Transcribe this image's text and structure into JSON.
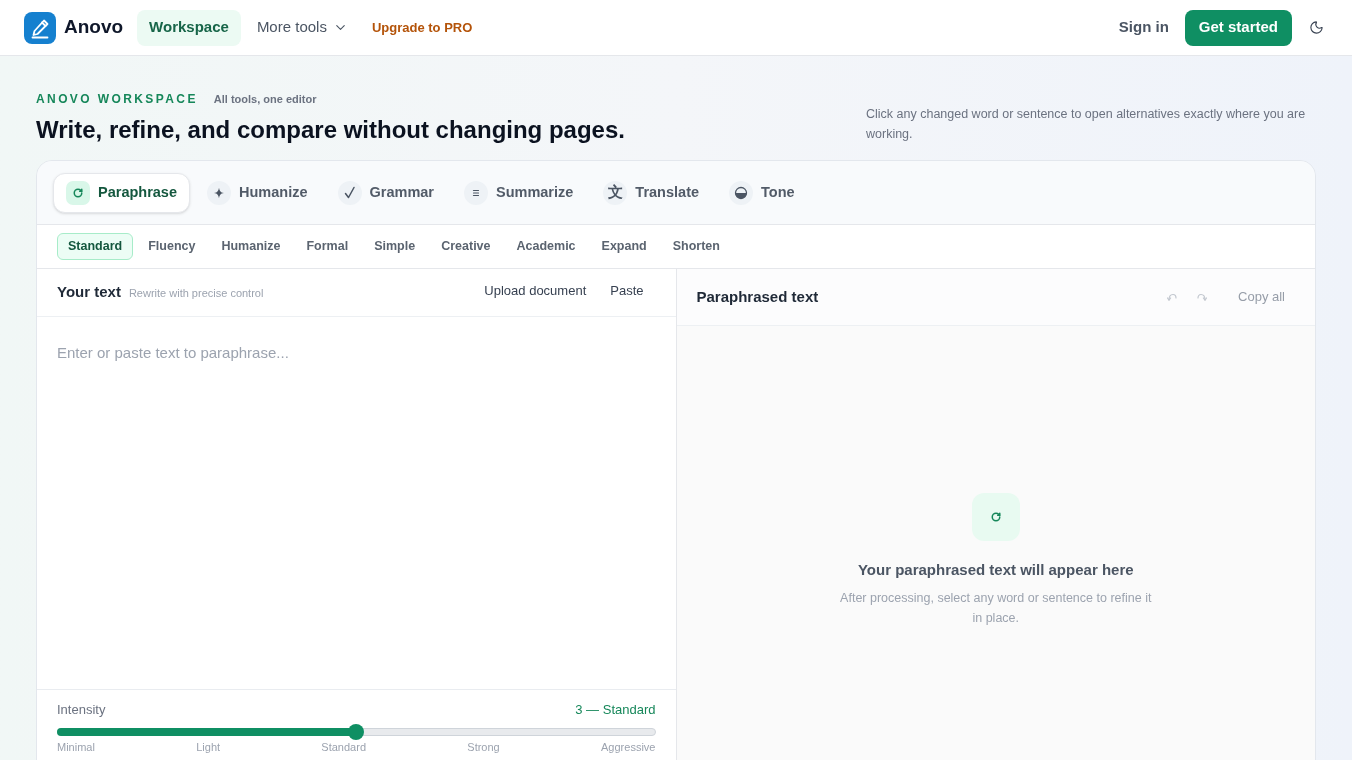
{
  "header": {
    "brand": "Anovo",
    "nav": [
      {
        "label": "Workspace",
        "kind": "link",
        "selected": true
      },
      {
        "label": "More tools",
        "kind": "dropdown",
        "selected": false
      }
    ],
    "upgrade": "Upgrade to PRO",
    "sign_in": "Sign in",
    "cta": "Get started"
  },
  "hero": {
    "eyebrow": "ANOVO WORKSPACE",
    "tagline": "All tools, one editor",
    "title": "Write, refine, and compare without changing pages.",
    "note": "Click any changed word or sentence to open alternatives exactly where you are working."
  },
  "tools": [
    {
      "label": "Paraphrase",
      "kind": "cycle",
      "selected": true
    },
    {
      "label": "Humanize",
      "kind": "sparkle",
      "selected": false
    },
    {
      "label": "Grammar",
      "kind": "check",
      "selected": false
    },
    {
      "label": "Summarize",
      "kind": "lines",
      "selected": false
    },
    {
      "label": "Translate",
      "kind": "glyph",
      "glyph": "文",
      "selected": false
    },
    {
      "label": "Tone",
      "kind": "half",
      "selected": false
    }
  ],
  "modes": [
    {
      "label": "Standard",
      "selected": true
    },
    {
      "label": "Fluency",
      "selected": false
    },
    {
      "label": "Humanize",
      "selected": false
    },
    {
      "label": "Formal",
      "selected": false
    },
    {
      "label": "Simple",
      "selected": false
    },
    {
      "label": "Creative",
      "selected": false
    },
    {
      "label": "Academic",
      "selected": false
    },
    {
      "label": "Expand",
      "selected": false
    },
    {
      "label": "Shorten",
      "selected": false
    }
  ],
  "editor": {
    "title": "Your text",
    "subtitle": "Rewrite with precise control",
    "actions": [
      "Upload document",
      "Paste"
    ],
    "placeholder": "Enter or paste text to paraphrase...",
    "intensity": {
      "label": "Intensity",
      "reading": "3 — Standard",
      "level": 0.5,
      "ticks": [
        "Minimal",
        "Light",
        "Standard",
        "Strong",
        "Aggressive"
      ]
    }
  },
  "output": {
    "title": "Paraphrased text",
    "actions": [
      {
        "kind": "undo",
        "disabled": true
      },
      {
        "kind": "redo",
        "disabled": true
      },
      {
        "kind": "copy",
        "label": "Copy all",
        "disabled": true
      }
    ],
    "empty": {
      "title": "Your paraphrased text will appear here",
      "body": "After processing, select any word or sentence to refine it in place."
    }
  }
}
